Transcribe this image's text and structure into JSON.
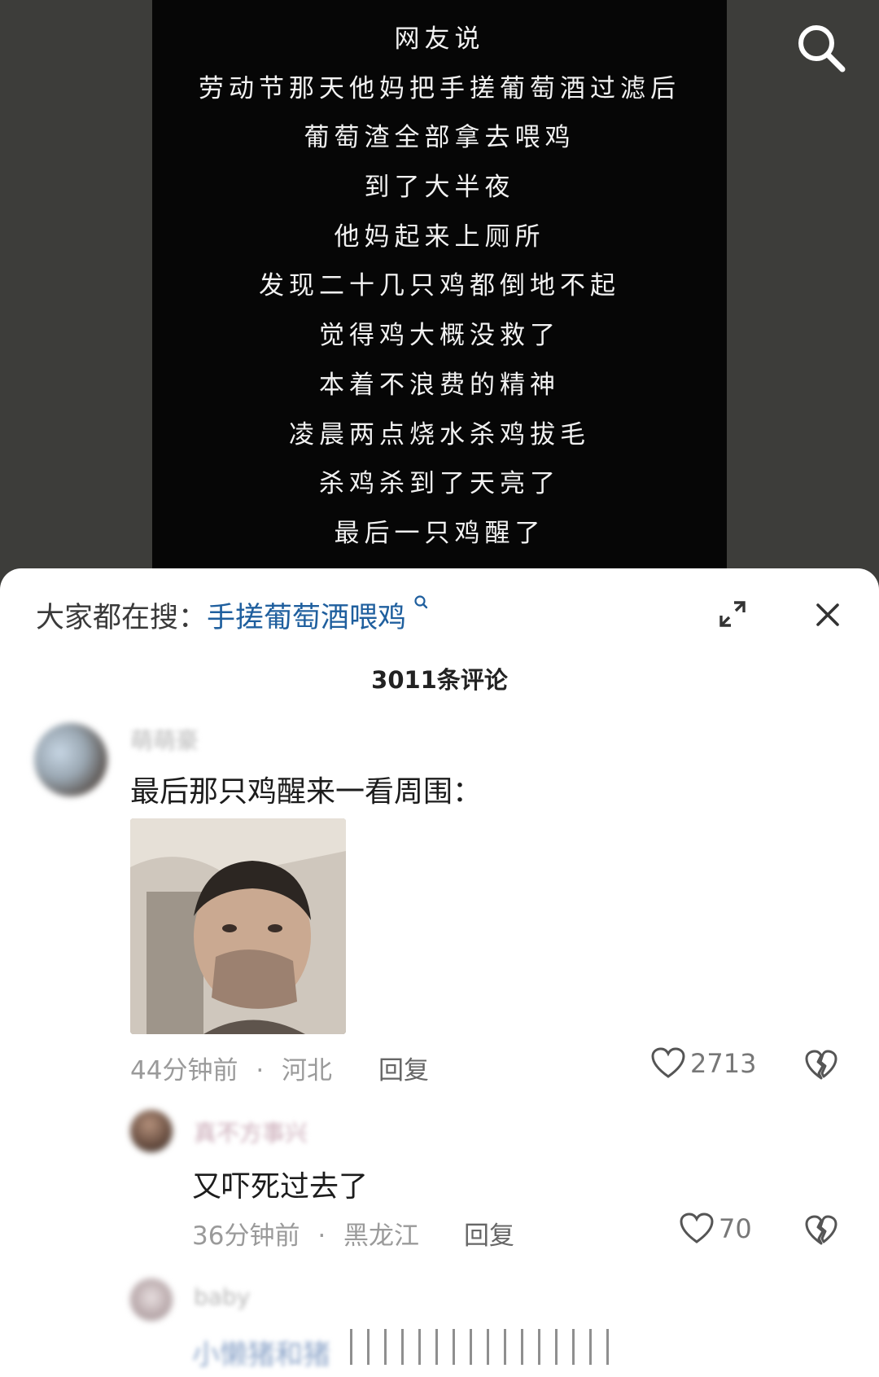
{
  "video": {
    "lines": [
      "网友说",
      "劳动节那天他妈把手搓葡萄酒过滤后",
      "葡萄渣全部拿去喂鸡",
      "到了大半夜",
      "他妈起来上厕所",
      "发现二十几只鸡都倒地不起",
      "觉得鸡大概没救了",
      "本着不浪费的精神",
      "凌晨两点烧水杀鸡拔毛",
      "杀鸡杀到了天亮了",
      "最后一只鸡醒了"
    ],
    "search_icon": "search-icon"
  },
  "sheet": {
    "hot_search_prefix": "大家都在搜：",
    "hot_search_keyword": "手搓葡萄酒喂鸡",
    "comment_count": "3011条评论"
  },
  "comments": [
    {
      "username_blurred": "萌萌豪",
      "text": "最后那只鸡醒来一看周围：",
      "has_image": true,
      "time": "44分钟前",
      "location": "河北",
      "reply_label": "回复",
      "likes": "2713"
    },
    {
      "username_blurred": "真不方事兴",
      "text": "又吓死过去了",
      "time": "36分钟前",
      "location": "黑龙江",
      "reply_label": "回复",
      "likes": "70"
    },
    {
      "username_blurred": "baby",
      "text_blurred": "小懒猪和猪"
    }
  ],
  "meta_separator": "·",
  "colors": {
    "video_bg": "#060606",
    "outer_bg": "#3d3d3a",
    "keyword": "#1f5f9e",
    "meta_gray": "#9a9a9a"
  }
}
